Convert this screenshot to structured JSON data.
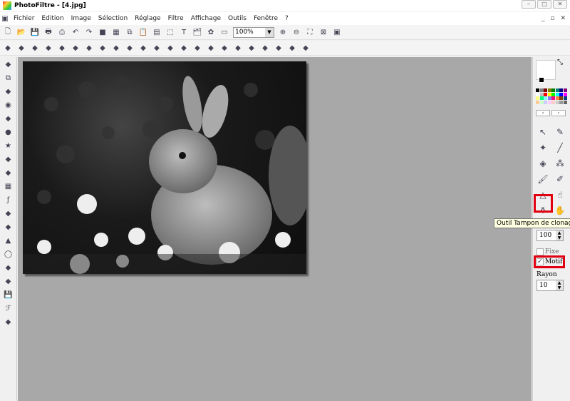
{
  "window": {
    "title": "PhotoFiltre - [4.jpg]",
    "buttons": [
      "–",
      "□",
      "✕"
    ]
  },
  "menu": [
    "Fichier",
    "Edition",
    "Image",
    "Sélection",
    "Réglage",
    "Filtre",
    "Affichage",
    "Outils",
    "Fenêtre",
    "?"
  ],
  "mdi_buttons": [
    "_",
    "▫",
    "✕"
  ],
  "toolbar1": {
    "zoom_value": "100%",
    "icons": [
      "new-icon",
      "open-icon",
      "save-icon",
      "print-icon",
      "scan-icon",
      "undo-icon",
      "redo-icon",
      "gray-icon",
      "color-icon",
      "copy-icon",
      "paste-icon",
      "paste-as-icon",
      "selection-icon",
      "text-icon",
      "explorer-icon",
      "plugin-icon",
      "window-icon"
    ],
    "zoom_icons": [
      "zoom-in-icon",
      "zoom-out-icon",
      "fit-icon",
      "actual-size-icon",
      "fullscreen-icon"
    ]
  },
  "toolbar2": {
    "icons": [
      "auto-levels-icon",
      "auto-contrast-icon",
      "brightness-minus-icon",
      "brightness-plus-icon",
      "contrast-minus-icon",
      "contrast-plus-icon",
      "saturation-minus-icon",
      "saturation-plus-icon",
      "gamma-minus-icon",
      "gamma-plus-icon",
      "grayscale-icon",
      "sepia-icon",
      "blur-icon",
      "soften-icon",
      "soften-more-icon",
      "sharpen-icon",
      "sharpen-more-icon",
      "rgb-icon",
      "colorize-icon",
      "vignette-icon",
      "flip-icon",
      "rotate-icon",
      "resize-icon"
    ]
  },
  "left_toolbar": [
    "calc-icon",
    "copy-icon",
    "monitor-icon",
    "orb-icon",
    "camera-icon",
    "globe-icon",
    "star-icon",
    "page-icon",
    "gradient-icon",
    "color-icon",
    "fx-icon",
    "pattern-icon",
    "grid-icon",
    "histogram-icon",
    "circle-icon",
    "book-icon",
    "export-icon",
    "save-icon",
    "font-icon",
    "html-icon"
  ],
  "tools": [
    "pointer-icon",
    "eyedropper-icon",
    "wand-icon",
    "line-icon",
    "fill-icon",
    "spray-icon",
    "brush-icon",
    "advanced-brush-icon",
    "blur-drop-icon",
    "smudge-icon",
    "clone-stamp-icon",
    "hand-icon"
  ],
  "tooltip": "Outil Tampon de clonage",
  "options": {
    "opacity": "100",
    "fixe_label": "Fixe",
    "fixe_checked": false,
    "motif_label": "Motif",
    "motif_checked": true,
    "rayon_label": "Rayon",
    "rayon_value": "10"
  },
  "palette_colors": [
    "#000000",
    "#808080",
    "#800000",
    "#808000",
    "#008000",
    "#008080",
    "#000080",
    "#800080",
    "#ffffff",
    "#c0c0c0",
    "#ff0000",
    "#ffff00",
    "#00ff00",
    "#00ffff",
    "#0000ff",
    "#ff00ff",
    "#ffff80",
    "#00ff80",
    "#80ffff",
    "#8080ff",
    "#ff0080",
    "#ff8040",
    "#804000",
    "#004080",
    "#ffcc99",
    "#ccffcc",
    "#ccccff",
    "#ffccff",
    "#ffcccc",
    "#cccccc",
    "#999999",
    "#666666"
  ],
  "highlight_color": "#e00010"
}
